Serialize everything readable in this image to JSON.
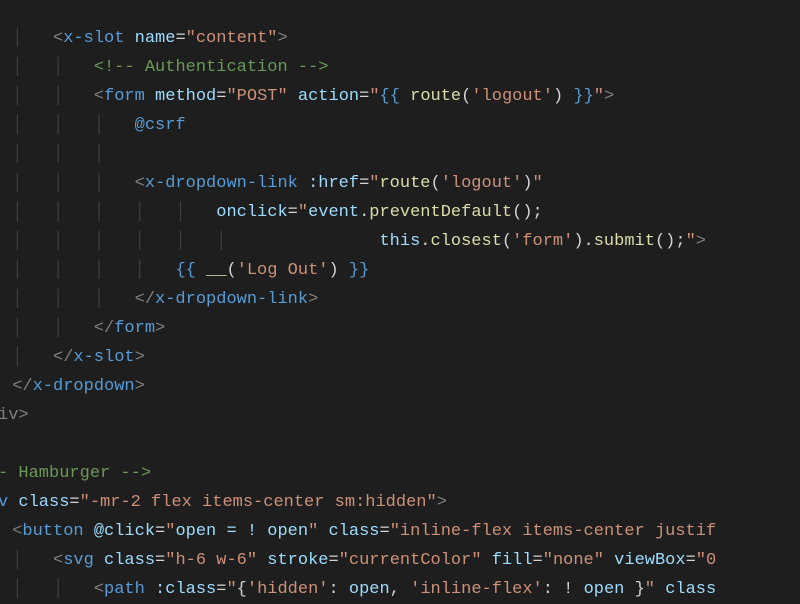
{
  "lines": [
    {
      "indent": 4,
      "guides": "│   ",
      "segments": [
        {
          "t": "<",
          "c": "bracket"
        },
        {
          "t": "x-slot",
          "c": "tag"
        },
        {
          "t": " ",
          "c": "text"
        },
        {
          "t": "name",
          "c": "attr"
        },
        {
          "t": "=",
          "c": "punct"
        },
        {
          "t": "\"content\"",
          "c": "str"
        },
        {
          "t": ">",
          "c": "bracket"
        }
      ]
    },
    {
      "indent": 8,
      "guides": "│   │   ",
      "segments": [
        {
          "t": "<!-- Authentication -->",
          "c": "comment"
        }
      ]
    },
    {
      "indent": 8,
      "guides": "│   │   ",
      "segments": [
        {
          "t": "<",
          "c": "bracket"
        },
        {
          "t": "form",
          "c": "tag"
        },
        {
          "t": " ",
          "c": "text"
        },
        {
          "t": "method",
          "c": "attr"
        },
        {
          "t": "=",
          "c": "punct"
        },
        {
          "t": "\"POST\"",
          "c": "str"
        },
        {
          "t": " ",
          "c": "text"
        },
        {
          "t": "action",
          "c": "attr"
        },
        {
          "t": "=",
          "c": "punct"
        },
        {
          "t": "\"",
          "c": "str"
        },
        {
          "t": "{{ ",
          "c": "blade"
        },
        {
          "t": "route",
          "c": "fn"
        },
        {
          "t": "(",
          "c": "punct"
        },
        {
          "t": "'logout'",
          "c": "str"
        },
        {
          "t": ")",
          "c": "punct"
        },
        {
          "t": " }}",
          "c": "blade"
        },
        {
          "t": "\"",
          "c": "str"
        },
        {
          "t": ">",
          "c": "bracket"
        }
      ]
    },
    {
      "indent": 12,
      "guides": "│   │   │   ",
      "segments": [
        {
          "t": "@csrf",
          "c": "blade"
        }
      ]
    },
    {
      "indent": 0,
      "guides": "│   │   │   ",
      "segments": []
    },
    {
      "indent": 12,
      "guides": "│   │   │   ",
      "segments": [
        {
          "t": "<",
          "c": "bracket"
        },
        {
          "t": "x-dropdown-link",
          "c": "tag"
        },
        {
          "t": " ",
          "c": "text"
        },
        {
          "t": ":href",
          "c": "attr"
        },
        {
          "t": "=",
          "c": "punct"
        },
        {
          "t": "\"",
          "c": "str"
        },
        {
          "t": "route",
          "c": "fn"
        },
        {
          "t": "(",
          "c": "punct"
        },
        {
          "t": "'logout'",
          "c": "str"
        },
        {
          "t": ")",
          "c": "punct"
        },
        {
          "t": "\"",
          "c": "str"
        }
      ]
    },
    {
      "indent": 20,
      "guides": "│   │   │   │   │   ",
      "segments": [
        {
          "t": "onclick",
          "c": "attr"
        },
        {
          "t": "=",
          "c": "punct"
        },
        {
          "t": "\"",
          "c": "str"
        },
        {
          "t": "event",
          "c": "var"
        },
        {
          "t": ".",
          "c": "punct"
        },
        {
          "t": "preventDefault",
          "c": "fn"
        },
        {
          "t": "();",
          "c": "punct"
        }
      ]
    },
    {
      "indent": 36,
      "guides": "│   │   │   │   │   │               ",
      "segments": [
        {
          "t": "this",
          "c": "var"
        },
        {
          "t": ".",
          "c": "punct"
        },
        {
          "t": "closest",
          "c": "fn"
        },
        {
          "t": "(",
          "c": "punct"
        },
        {
          "t": "'form'",
          "c": "str"
        },
        {
          "t": ").",
          "c": "punct"
        },
        {
          "t": "submit",
          "c": "fn"
        },
        {
          "t": "();",
          "c": "punct"
        },
        {
          "t": "\"",
          "c": "str"
        },
        {
          "t": ">",
          "c": "bracket"
        }
      ]
    },
    {
      "indent": 16,
      "guides": "│   │   │   │   ",
      "segments": [
        {
          "t": "{{ ",
          "c": "blade"
        },
        {
          "t": "__",
          "c": "fn"
        },
        {
          "t": "(",
          "c": "punct"
        },
        {
          "t": "'Log Out'",
          "c": "str"
        },
        {
          "t": ")",
          "c": "punct"
        },
        {
          "t": " }}",
          "c": "blade"
        }
      ]
    },
    {
      "indent": 12,
      "guides": "│   │   │   ",
      "segments": [
        {
          "t": "</",
          "c": "bracket"
        },
        {
          "t": "x-dropdown-link",
          "c": "tag"
        },
        {
          "t": ">",
          "c": "bracket"
        }
      ]
    },
    {
      "indent": 8,
      "guides": "│   │   ",
      "segments": [
        {
          "t": "</",
          "c": "bracket"
        },
        {
          "t": "form",
          "c": "tag"
        },
        {
          "t": ">",
          "c": "bracket"
        }
      ]
    },
    {
      "indent": 4,
      "guides": "│   ",
      "segments": [
        {
          "t": "</",
          "c": "bracket"
        },
        {
          "t": "x-slot",
          "c": "tag"
        },
        {
          "t": ">",
          "c": "bracket"
        }
      ]
    },
    {
      "indent": 0,
      "guides": "",
      "segments": [
        {
          "t": "</",
          "c": "bracket"
        },
        {
          "t": "x-dropdown",
          "c": "tag"
        },
        {
          "t": ">",
          "c": "bracket"
        }
      ]
    },
    {
      "indent": 0,
      "guides": "",
      "pref": "iv",
      "segments": [
        {
          "t": ">",
          "c": "bracket"
        }
      ]
    },
    {
      "indent": 0,
      "guides": "",
      "segments": []
    },
    {
      "indent": 0,
      "guides": "",
      "pref": "- ",
      "segments": [
        {
          "t": "Hamburger -->",
          "c": "comment"
        }
      ]
    },
    {
      "indent": 0,
      "guides": "",
      "pref": "v ",
      "segments": [
        {
          "t": "class",
          "c": "attr"
        },
        {
          "t": "=",
          "c": "punct"
        },
        {
          "t": "\"-mr-2 flex items-center sm:hidden\"",
          "c": "str"
        },
        {
          "t": ">",
          "c": "bracket"
        }
      ]
    },
    {
      "indent": 0,
      "guides": "",
      "segments": [
        {
          "t": "<",
          "c": "bracket"
        },
        {
          "t": "button",
          "c": "tag"
        },
        {
          "t": " ",
          "c": "text"
        },
        {
          "t": "@click",
          "c": "attr"
        },
        {
          "t": "=",
          "c": "punct"
        },
        {
          "t": "\"",
          "c": "str"
        },
        {
          "t": "open = ! open",
          "c": "var"
        },
        {
          "t": "\"",
          "c": "str"
        },
        {
          "t": " ",
          "c": "text"
        },
        {
          "t": "class",
          "c": "attr"
        },
        {
          "t": "=",
          "c": "punct"
        },
        {
          "t": "\"inline-flex items-center justif",
          "c": "str"
        }
      ]
    },
    {
      "indent": 4,
      "guides": "│   ",
      "segments": [
        {
          "t": "<",
          "c": "bracket"
        },
        {
          "t": "svg",
          "c": "tag"
        },
        {
          "t": " ",
          "c": "text"
        },
        {
          "t": "class",
          "c": "attr"
        },
        {
          "t": "=",
          "c": "punct"
        },
        {
          "t": "\"h-6 w-6\"",
          "c": "str"
        },
        {
          "t": " ",
          "c": "text"
        },
        {
          "t": "stroke",
          "c": "attr"
        },
        {
          "t": "=",
          "c": "punct"
        },
        {
          "t": "\"currentColor\"",
          "c": "str"
        },
        {
          "t": " ",
          "c": "text"
        },
        {
          "t": "fill",
          "c": "attr"
        },
        {
          "t": "=",
          "c": "punct"
        },
        {
          "t": "\"none\"",
          "c": "str"
        },
        {
          "t": " ",
          "c": "text"
        },
        {
          "t": "viewBox",
          "c": "attr"
        },
        {
          "t": "=",
          "c": "punct"
        },
        {
          "t": "\"0",
          "c": "str"
        }
      ]
    },
    {
      "indent": 8,
      "guides": "│   │   ",
      "segments": [
        {
          "t": "<",
          "c": "bracket"
        },
        {
          "t": "path",
          "c": "tag"
        },
        {
          "t": " ",
          "c": "text"
        },
        {
          "t": ":class",
          "c": "attr"
        },
        {
          "t": "=",
          "c": "punct"
        },
        {
          "t": "\"",
          "c": "str"
        },
        {
          "t": "{",
          "c": "punct"
        },
        {
          "t": "'hidden'",
          "c": "str"
        },
        {
          "t": ": ",
          "c": "punct"
        },
        {
          "t": "open",
          "c": "var"
        },
        {
          "t": ", ",
          "c": "punct"
        },
        {
          "t": "'inline-flex'",
          "c": "str"
        },
        {
          "t": ": ! ",
          "c": "punct"
        },
        {
          "t": "open",
          "c": "var"
        },
        {
          "t": " }",
          "c": "punct"
        },
        {
          "t": "\"",
          "c": "str"
        },
        {
          "t": " ",
          "c": "text"
        },
        {
          "t": "class",
          "c": "attr"
        }
      ]
    }
  ],
  "baseIndentPx": 14,
  "indentUnitPx": 10
}
